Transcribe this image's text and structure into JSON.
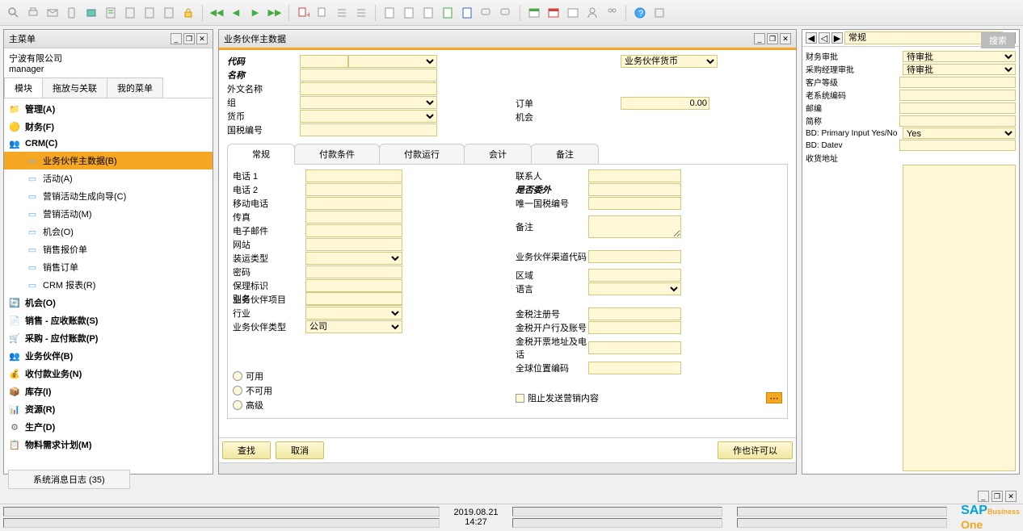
{
  "toolbar_icons": [
    "search",
    "print",
    "mail",
    "sms",
    "fax",
    "doc",
    "excel",
    "word",
    "acrobat",
    "lock",
    "back-all",
    "back",
    "forward",
    "forward-all",
    "add",
    "find",
    "list1",
    "list2",
    "doc1",
    "doc2",
    "edit",
    "add-doc",
    "settings",
    "chat1",
    "chat2",
    "cal",
    "cal2",
    "date",
    "user",
    "users",
    "help",
    "tool"
  ],
  "left_panel": {
    "title": "主菜单",
    "company": "宁波有限公司",
    "user": "manager",
    "tabs": [
      "模块",
      "拖放与关联",
      "我的菜单"
    ],
    "tree": [
      {
        "icon": "📁",
        "label": "管理(A)",
        "color": "#cc9900"
      },
      {
        "icon": "🟡",
        "label": "财务(F)",
        "color": "#cc9900"
      },
      {
        "icon": "👥",
        "label": "CRM(C)",
        "color": "#3399cc",
        "expanded": true,
        "children": [
          {
            "label": "业务伙伴主数据(B)",
            "selected": true
          },
          {
            "label": "活动(A)"
          },
          {
            "label": "营销活动生成向导(C)"
          },
          {
            "label": "营销活动(M)"
          },
          {
            "label": "机会(O)"
          },
          {
            "label": "销售报价单"
          },
          {
            "label": "销售订单"
          },
          {
            "label": "CRM 报表(R)"
          }
        ]
      },
      {
        "icon": "🔄",
        "label": "机会(O)",
        "color": "#009900"
      },
      {
        "icon": "📄",
        "label": "销售 - 应收账款(S)",
        "color": "#3366cc"
      },
      {
        "icon": "🛒",
        "label": "采购 - 应付账款(P)",
        "color": "#cc6600"
      },
      {
        "icon": "👥",
        "label": "业务伙伴(B)",
        "color": "#3399cc"
      },
      {
        "icon": "💰",
        "label": "收付款业务(N)",
        "color": "#cc9900"
      },
      {
        "icon": "📦",
        "label": "库存(I)",
        "color": "#666"
      },
      {
        "icon": "📊",
        "label": "资源(R)",
        "color": "#3366cc"
      },
      {
        "icon": "⚙",
        "label": "生产(D)",
        "color": "#666"
      },
      {
        "icon": "📋",
        "label": "物料需求计划(M)",
        "color": "#666"
      }
    ]
  },
  "center_panel": {
    "title": "业务伙伴主数据",
    "header_fields": {
      "code": "代码",
      "name": "名称",
      "foreign_name": "外文名称",
      "group": "组",
      "currency": "货币",
      "tax_id": "国税编号",
      "bp_currency": "业务伙伴货币",
      "order": "订单",
      "opportunity": "机会",
      "order_value": "0.00"
    },
    "tabs": [
      "常规",
      "付款条件",
      "付款运行",
      "会计",
      "备注"
    ],
    "general": {
      "left": [
        {
          "l": "电话 1"
        },
        {
          "l": "电话 2"
        },
        {
          "l": "移动电话"
        },
        {
          "l": "传真"
        },
        {
          "l": "电子邮件"
        },
        {
          "l": "网站"
        },
        {
          "l": "装运类型",
          "sel": true
        },
        {
          "l": "密码"
        },
        {
          "l": "保理标识"
        },
        {
          "l": "业务伙伴项目"
        },
        {
          "l": "行业",
          "sel": true
        },
        {
          "l": "业务伙伴类型",
          "sel": true,
          "v": "公司"
        }
      ],
      "alias": "别名",
      "right": [
        {
          "l": "联系人"
        },
        {
          "l": "是否委外",
          "italic": true
        },
        {
          "l": "唯一国税编号"
        }
      ],
      "remark": "备注",
      "right2": [
        {
          "l": "业务伙伴渠道代码"
        }
      ],
      "right3": [
        {
          "l": "区域"
        },
        {
          "l": "语言",
          "sel": true
        }
      ],
      "right4": [
        {
          "l": "金税注册号"
        },
        {
          "l": "金税开户行及账号"
        },
        {
          "l": "金税开票地址及电话"
        },
        {
          "l": "全球位置编码"
        }
      ],
      "block_marketing": "阻止发送营销内容",
      "radios": [
        "可用",
        "不可用",
        "高级"
      ]
    },
    "buttons": {
      "find": "查找",
      "cancel": "取消",
      "permit": "作也许可以"
    }
  },
  "right_panel": {
    "dropdown": "常规",
    "fields": [
      {
        "l": "财务审批",
        "v": "待审批",
        "sel": true
      },
      {
        "l": "采购经理审批",
        "v": "待审批",
        "sel": true
      },
      {
        "l": "客户等级"
      },
      {
        "l": "老系统编码"
      },
      {
        "l": "邮编"
      },
      {
        "l": "简称"
      },
      {
        "l": "BD: Primary Input Yes/No",
        "v": "Yes",
        "sel": true
      },
      {
        "l": "BD: Datev"
      },
      {
        "l": "收货地址",
        "big": true
      }
    ]
  },
  "search_label": "搜索",
  "log_tab": "系统消息日志 (35)",
  "status": {
    "date": "2019.08.21",
    "time": "14:27"
  },
  "brand": {
    "sap": "SAP",
    "biz": "Business",
    "one": "One"
  }
}
